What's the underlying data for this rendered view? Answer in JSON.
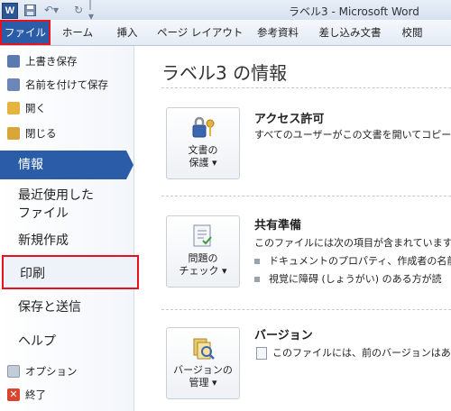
{
  "window": {
    "title": "ラベル3 - Microsoft Word",
    "app_icon_letter": "W"
  },
  "quick_access": {
    "save_icon": "save-icon",
    "undo_icon": "undo-icon",
    "redo_icon": "redo-icon"
  },
  "ribbon": {
    "tabs": [
      "ファイル",
      "ホーム",
      "挿入",
      "ページ レイアウト",
      "参考資料",
      "差し込み文書",
      "校閲"
    ]
  },
  "backstage_nav": {
    "small_items": [
      "上書き保存",
      "名前を付けて保存",
      "開く",
      "閉じる"
    ],
    "info": "情報",
    "recent_line1": "最近使用した",
    "recent_line2": "ファイル",
    "new": "新規作成",
    "print": "印刷",
    "save_send": "保存と送信",
    "help": "ヘルプ",
    "options": "オプション",
    "exit": "終了"
  },
  "info_page": {
    "title": "ラベル3 の情報",
    "sections": [
      {
        "button_line1": "文書の",
        "button_line2": "保護",
        "heading": "アクセス許可",
        "text": "すべてのユーザーがこの文書を開いてコピーや"
      },
      {
        "button_line1": "問題の",
        "button_line2": "チェック",
        "heading": "共有準備",
        "text": "このファイルには次の項目が含まれています。",
        "bullets": [
          "ドキュメントのプロパティ、作成者の名前",
          "視覚に障碍 (しょうがい) のある方が読"
        ]
      },
      {
        "button_line1": "バージョンの",
        "button_line2": "管理",
        "heading": "バージョン",
        "text": "このファイルには、前のバージョンはありま"
      }
    ]
  },
  "colors": {
    "accent": "#2a5ca8",
    "highlight": "#e8121e"
  }
}
